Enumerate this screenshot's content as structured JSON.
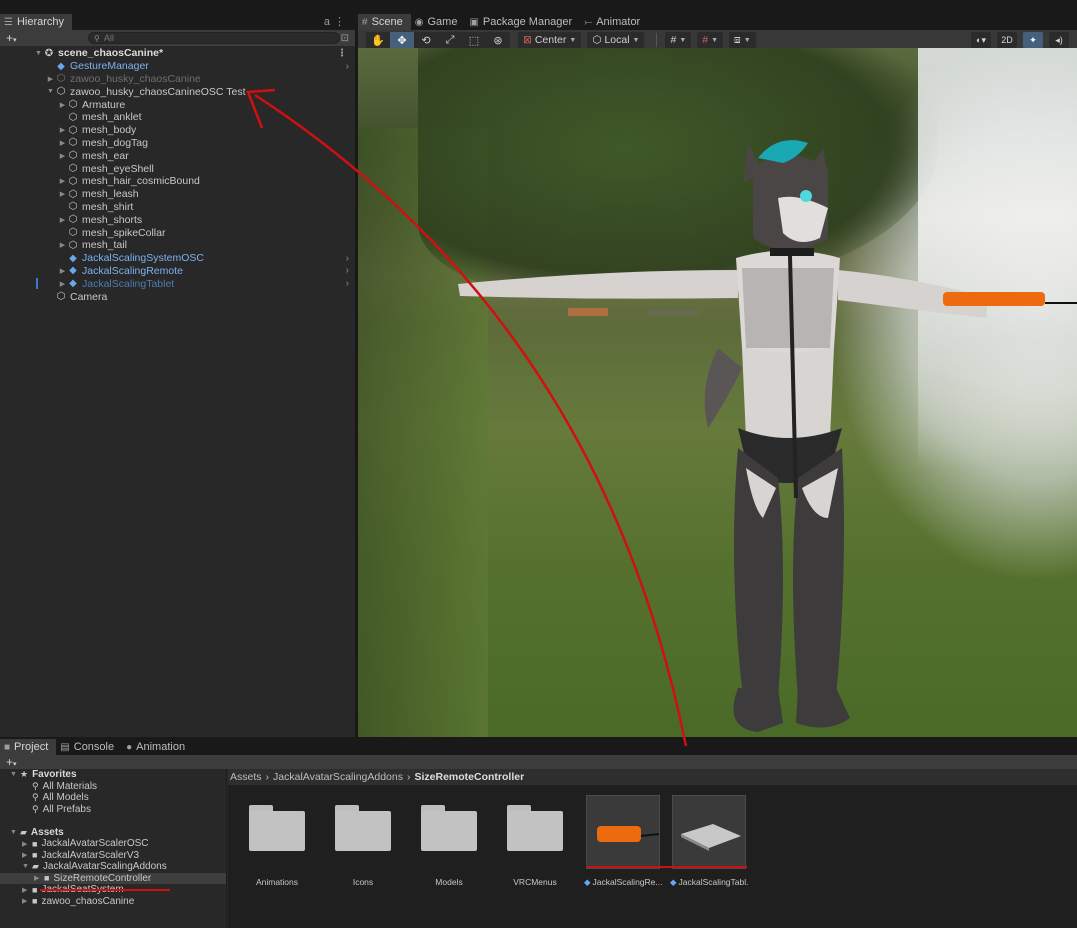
{
  "hierarchy": {
    "tab_label": "Hierarchy",
    "search_placeholder": "All",
    "add_label": "+",
    "rows": [
      {
        "label": "scene_chaosCanine*"
      },
      {
        "label": "GestureManager"
      },
      {
        "label": "zawoo_husky_chaosCanine"
      },
      {
        "label": "zawoo_husky_chaosCanineOSC Test"
      },
      {
        "label": "Armature"
      },
      {
        "label": "mesh_anklet"
      },
      {
        "label": "mesh_body"
      },
      {
        "label": "mesh_dogTag"
      },
      {
        "label": "mesh_ear"
      },
      {
        "label": "mesh_eyeShell"
      },
      {
        "label": "mesh_hair_cosmicBound"
      },
      {
        "label": "mesh_leash"
      },
      {
        "label": "mesh_shirt"
      },
      {
        "label": "mesh_shorts"
      },
      {
        "label": "mesh_spikeCollar"
      },
      {
        "label": "mesh_tail"
      },
      {
        "label": "JackalScalingSystemOSC"
      },
      {
        "label": "JackalScalingRemote"
      },
      {
        "label": "JackalScalingTablet"
      },
      {
        "label": "Camera"
      }
    ]
  },
  "scene_tabs": {
    "scene": "Scene",
    "game": "Game",
    "package_manager": "Package Manager",
    "animator": "Animator"
  },
  "scene_toolbar": {
    "pivot": "Center",
    "space": "Local",
    "mode_2d": "2D"
  },
  "project_tabs": {
    "project": "Project",
    "console": "Console",
    "animation": "Animation"
  },
  "project": {
    "favorites_label": "Favorites",
    "favorites": [
      "All Materials",
      "All Models",
      "All Prefabs"
    ],
    "assets_label": "Assets",
    "folders": [
      "JackalAvatarScalerOSC",
      "JackalAvatarScalerV3",
      "JackalAvatarScalingAddons",
      "SizeRemoteController",
      "JackalSeatSystem",
      "zawoo_chaosCanine"
    ],
    "breadcrumb": [
      "Assets",
      "JackalAvatarScalingAddons",
      "SizeRemoteController"
    ],
    "items": [
      {
        "name": "Animations"
      },
      {
        "name": "Icons"
      },
      {
        "name": "Models"
      },
      {
        "name": "VRCMenus"
      },
      {
        "name": "JackalScalingRe..."
      },
      {
        "name": "JackalScalingTabl..."
      }
    ]
  },
  "colors": {
    "annotation": "#d01010",
    "prefab_blue": "#6aa7ee",
    "panel_bg": "#282828"
  }
}
